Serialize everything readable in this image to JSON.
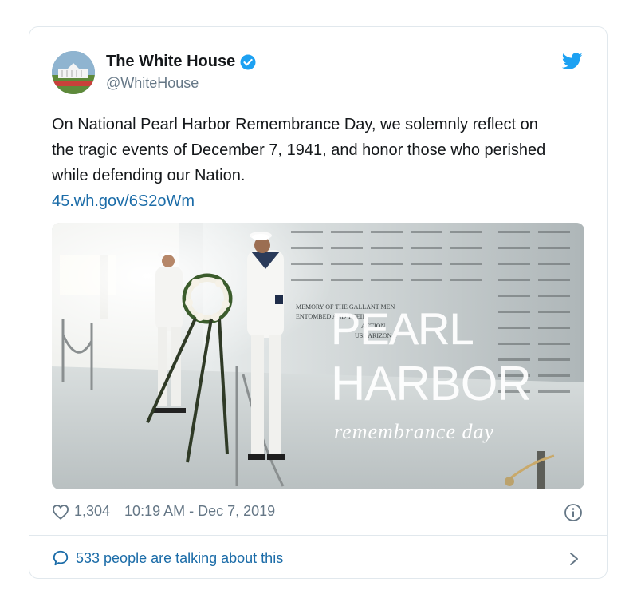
{
  "author": {
    "name": "The White House",
    "handle": "@WhiteHouse",
    "verified": true
  },
  "tweet": {
    "text": "On National Pearl Harbor Remembrance Day, we solemnly reflect on the tragic events of December 7, 1941, and honor those who perished while defending our Nation.",
    "link": "45.wh.gov/6S2oWm"
  },
  "media": {
    "title_line1": "PEARL",
    "title_line2": "HARBOR",
    "subtitle": "remembrance day",
    "wall_text": [
      "MEMORY OF THE GALLANT MEN",
      "ENTOMBED AND THEIR",
      "ACTION",
      "USS ARIZONA"
    ]
  },
  "meta": {
    "likes": "1,304",
    "timestamp": "10:19 AM - Dec 7, 2019"
  },
  "footer": {
    "talking": "533 people are talking about this"
  },
  "colors": {
    "brand_blue": "#1da1f2",
    "link": "#1b6ca8",
    "secondary_text": "#657786",
    "border": "#e1e8ed"
  },
  "icons": [
    "avatar-white-house",
    "verified-badge-icon",
    "twitter-bird-icon",
    "heart-icon",
    "info-icon",
    "comment-bubble-icon",
    "chevron-right-icon"
  ]
}
